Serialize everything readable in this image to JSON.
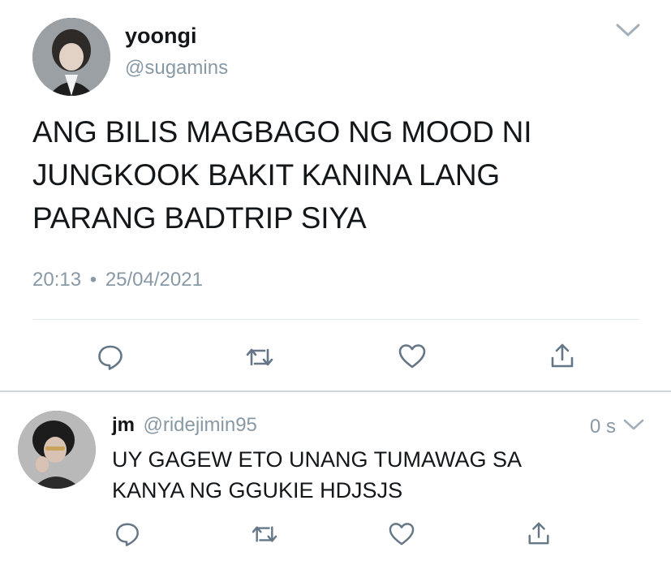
{
  "tweet": {
    "display_name": "yoongi",
    "handle": "@sugamins",
    "text_lines": [
      "ANG BILIS MAGBAGO NG MOOD NI",
      "JUNGKOOK BAKIT KANINA LANG",
      "PARANG BADTRIP SIYA"
    ],
    "time": "20:13",
    "separator": "•",
    "date": "25/04/2021",
    "avatar_icon": "avatar-photo-icon",
    "menu_icon": "chevron-down-icon"
  },
  "actions": {
    "icons": [
      "reply-icon",
      "retweet-icon",
      "like-icon",
      "share-icon"
    ]
  },
  "reply": {
    "display_name": "jm",
    "handle": "@ridejimin95",
    "time": "0 s",
    "text_lines": [
      "UY GAGEW ETO UNANG TUMAWAG SA",
      "KANYA NG GGUKIE HDJSJS"
    ],
    "avatar_icon": "avatar-photo-icon",
    "menu_icon": "chevron-down-icon"
  },
  "colors": {
    "text": "#14171a",
    "secondary": "#8899a6",
    "icon": "#657786",
    "divider": "#e1e8ed"
  }
}
